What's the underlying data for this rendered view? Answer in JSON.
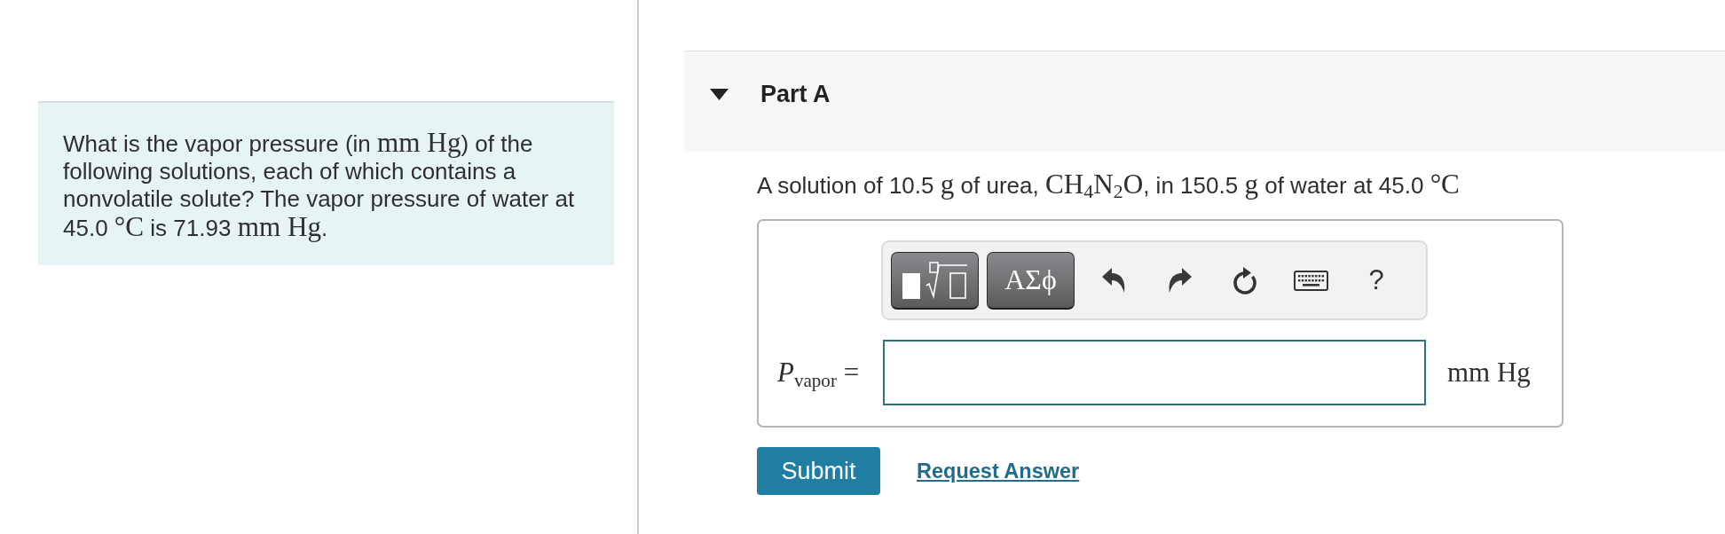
{
  "problem": {
    "intro": [
      {
        "kind": "text",
        "text": "What is the vapor pressure (in "
      },
      {
        "kind": "math",
        "text": "mm Hg"
      },
      {
        "kind": "text",
        "text": ") of the following solutions, each of which contains a nonvolatile solute? The vapor pressure of water at 45.0 "
      },
      {
        "kind": "math",
        "text": "°C"
      },
      {
        "kind": "text",
        "text": " is 71.93 "
      },
      {
        "kind": "math",
        "text": "mm Hg"
      },
      {
        "kind": "text",
        "text": "."
      }
    ]
  },
  "part": {
    "title": "Part A",
    "expanded": true,
    "question": [
      {
        "kind": "text",
        "text": "A solution of 10.5 "
      },
      {
        "kind": "math",
        "text": "g"
      },
      {
        "kind": "text",
        "text": " of urea, "
      },
      {
        "kind": "math",
        "text": "CH$_{4}$N$_{2}$O"
      },
      {
        "kind": "text",
        "text": ", in 150.5 "
      },
      {
        "kind": "math",
        "text": "g"
      },
      {
        "kind": "text",
        "text": " of water at 45.0 "
      },
      {
        "kind": "math",
        "text": "°C"
      }
    ],
    "answer": {
      "toolbar": [
        {
          "kind": "templates"
        },
        {
          "kind": "symbols",
          "label": "ΑΣϕ"
        },
        {
          "kind": "undo"
        },
        {
          "kind": "redo"
        },
        {
          "kind": "reset"
        },
        {
          "kind": "keyboard"
        },
        {
          "kind": "help",
          "label": "?"
        }
      ],
      "label": "*P*$_{vapor}$ =",
      "units": "mm Hg"
    },
    "actions": {
      "submit": "Submit",
      "request": "Request Answer"
    }
  }
}
